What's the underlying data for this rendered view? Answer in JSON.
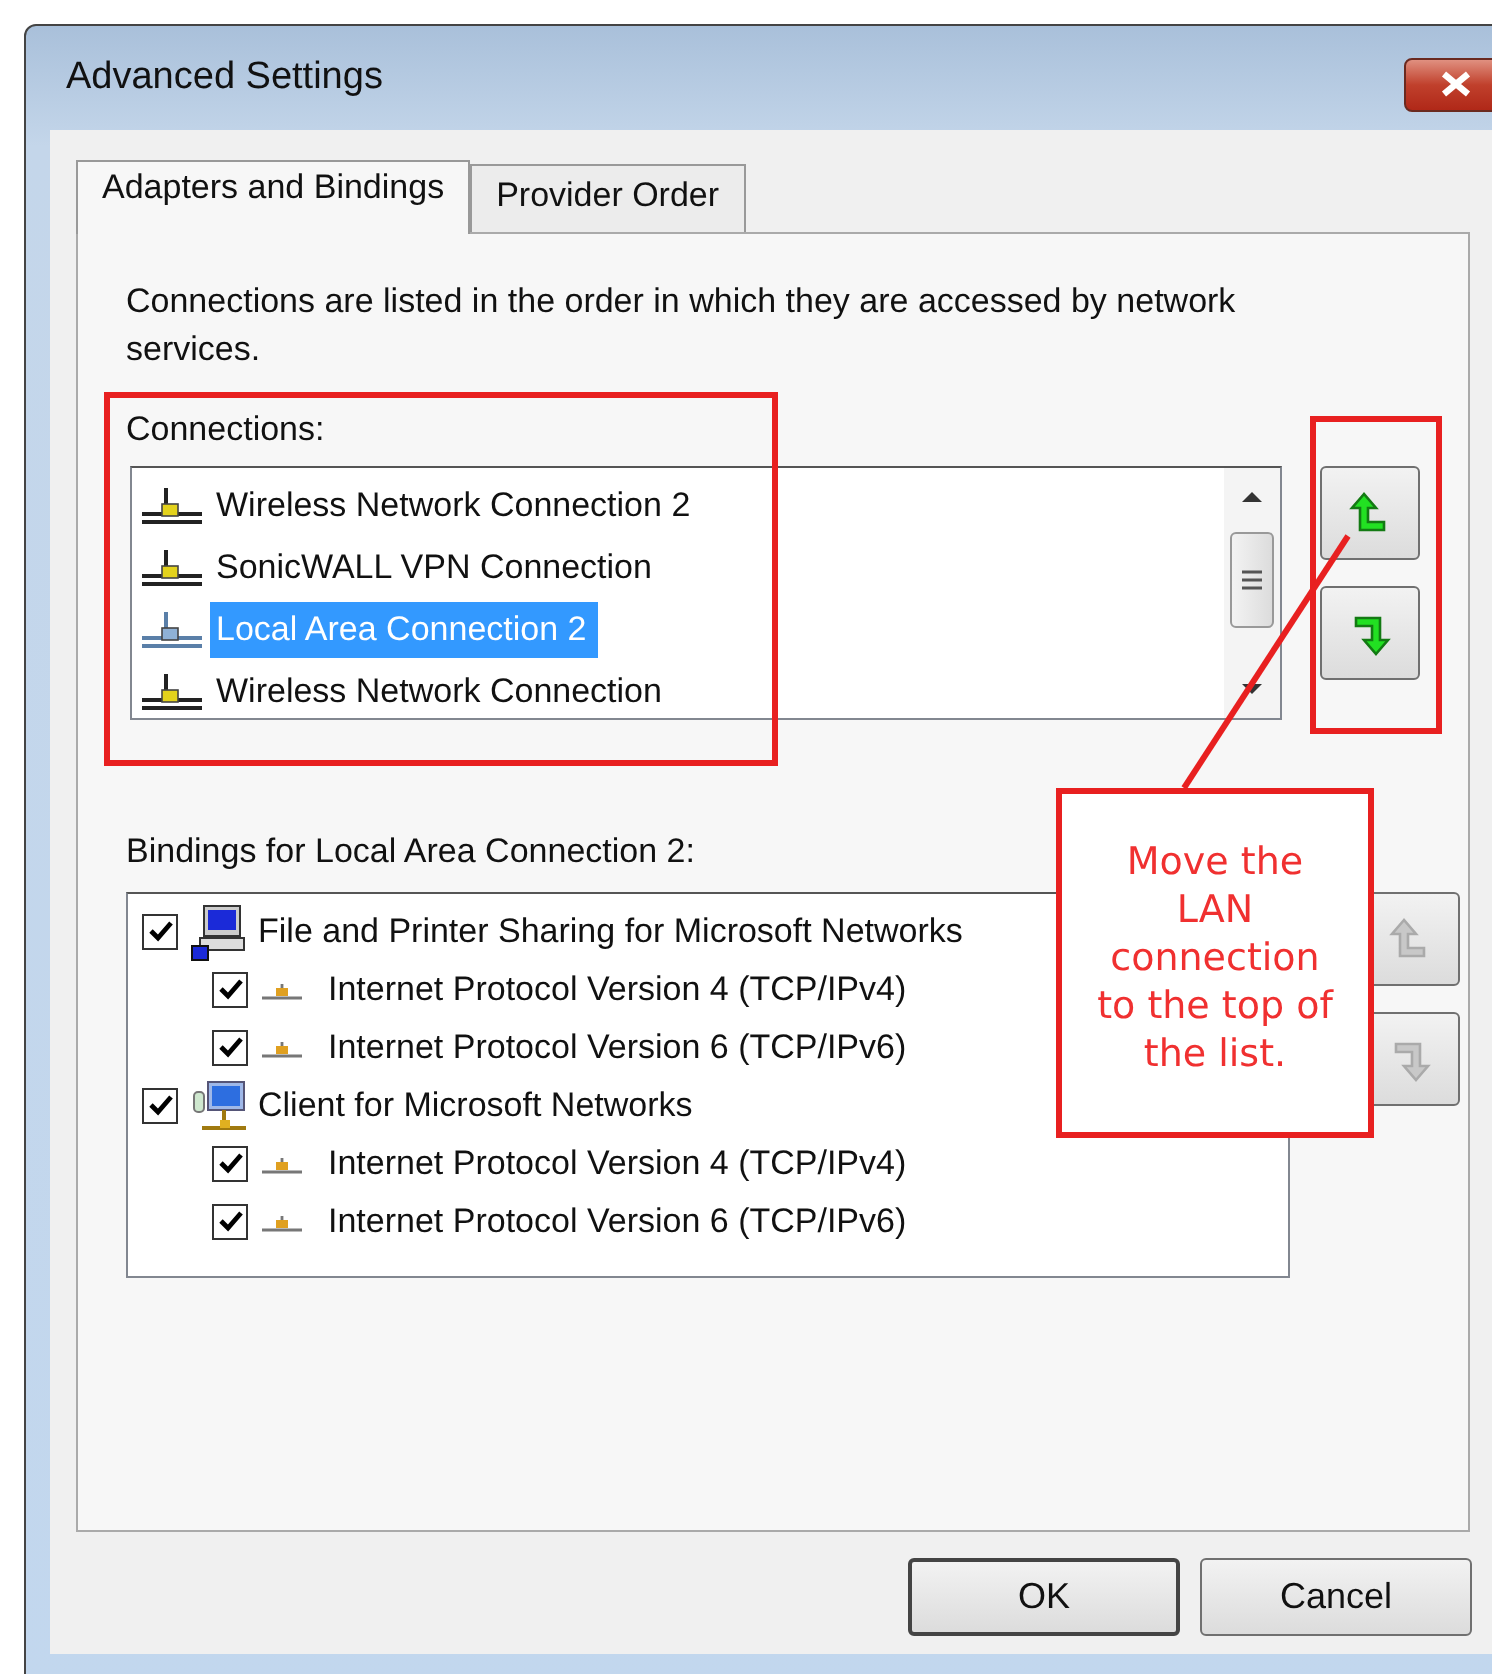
{
  "window": {
    "title": "Advanced Settings"
  },
  "tabs": [
    {
      "label": "Adapters and Bindings",
      "selected": true
    },
    {
      "label": "Provider Order",
      "selected": false
    }
  ],
  "description": "Connections are listed in the order in which they are accessed by network services.",
  "connections": {
    "label": "Connections:",
    "move_disabled": false,
    "items": [
      {
        "name": "Wireless Network Connection 2",
        "selected": false
      },
      {
        "name": "SonicWALL VPN Connection",
        "selected": false
      },
      {
        "name": "Local Area Connection 2",
        "selected": true
      },
      {
        "name": "Wireless Network Connection",
        "selected": false
      }
    ]
  },
  "bindings": {
    "label": "Bindings for Local Area Connection 2:",
    "move_disabled": true,
    "items": [
      {
        "name": "File and Printer Sharing for Microsoft Networks",
        "checked": true,
        "kind": "server",
        "children": [
          {
            "name": "Internet Protocol Version 4 (TCP/IPv4)",
            "checked": true
          },
          {
            "name": "Internet Protocol Version 6 (TCP/IPv6)",
            "checked": true
          }
        ]
      },
      {
        "name": "Client for Microsoft Networks",
        "checked": true,
        "kind": "client",
        "children": [
          {
            "name": "Internet Protocol Version 4 (TCP/IPv4)",
            "checked": true
          },
          {
            "name": "Internet Protocol Version 6 (TCP/IPv6)",
            "checked": true
          }
        ]
      }
    ]
  },
  "annotation": {
    "text": "Move the LAN connection to the top of the list."
  },
  "buttons": [
    "OK",
    "Cancel"
  ]
}
